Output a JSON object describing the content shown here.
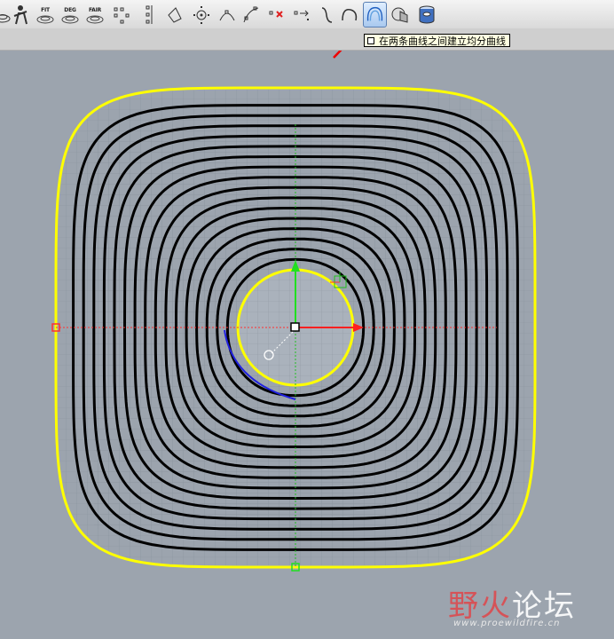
{
  "toolbar": {
    "buttons": [
      {
        "name": "surface-tool-icon"
      },
      {
        "name": "analysis-figure-icon"
      },
      {
        "name": "fit-button",
        "caption": "FIT"
      },
      {
        "name": "deg-button",
        "caption": "DEG"
      },
      {
        "name": "fair-button",
        "caption": "FAIR"
      },
      {
        "name": "control-points-icon"
      },
      {
        "name": "point-column-icon"
      },
      {
        "name": "polygon-curve-icon"
      },
      {
        "name": "circle-point-icon"
      },
      {
        "name": "point-on-curve-icon"
      },
      {
        "name": "add-point-icon"
      },
      {
        "name": "delete-point-icon"
      },
      {
        "name": "point-arrow-icon"
      },
      {
        "name": "curve-hook-icon"
      },
      {
        "name": "curve-loop-icon"
      },
      {
        "name": "blend-curves-icon"
      },
      {
        "name": "surface-round-icon"
      },
      {
        "name": "cylinder-icon"
      }
    ],
    "tooltip": "在两条曲线之间建立均分曲线"
  },
  "colors": {
    "background": "#9ca4ae",
    "curves": "#000000",
    "boundary": "#ffff00",
    "x_axis": "#ff2020",
    "y_axis": "#20d020",
    "selected_curve": "#2020e0",
    "arrow": "#ee0000"
  },
  "viewport": {
    "inner_curves": 16
  },
  "watermark": {
    "red_part": "野火",
    "white_part": "论坛",
    "url": "www.proewildfire.cn"
  }
}
